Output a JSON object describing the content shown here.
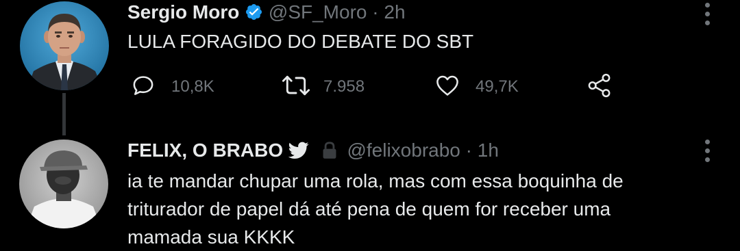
{
  "tweets": [
    {
      "author_name": "Sergio Moro",
      "verified": true,
      "handle": "@SF_Moro",
      "separator": "·",
      "time": "2h",
      "text": "LULA FORAGIDO DO DEBATE DO SBT",
      "actions": {
        "reply_icon": "reply-icon",
        "reply_count": "10,8K",
        "retweet_icon": "retweet-icon",
        "retweet_count": "7.958",
        "like_icon": "heart-icon",
        "like_count": "49,7K",
        "share_icon": "share-icon"
      }
    },
    {
      "author_name": "FELIX, O BRABO",
      "emoji": "bird-emoji",
      "protected": true,
      "handle": "@felixobrabo",
      "separator": "·",
      "time": "1h",
      "text": "ia te mandar chupar uma rola, mas com essa boquinha de triturador de papel dá até pena de quem for receber uma mamada sua KKKK"
    }
  ],
  "colors": {
    "background": "#000000",
    "primary_text": "#e7e9ea",
    "secondary_text": "#71767b",
    "verified_blue": "#1d9bf0",
    "thread_line": "#333639"
  }
}
